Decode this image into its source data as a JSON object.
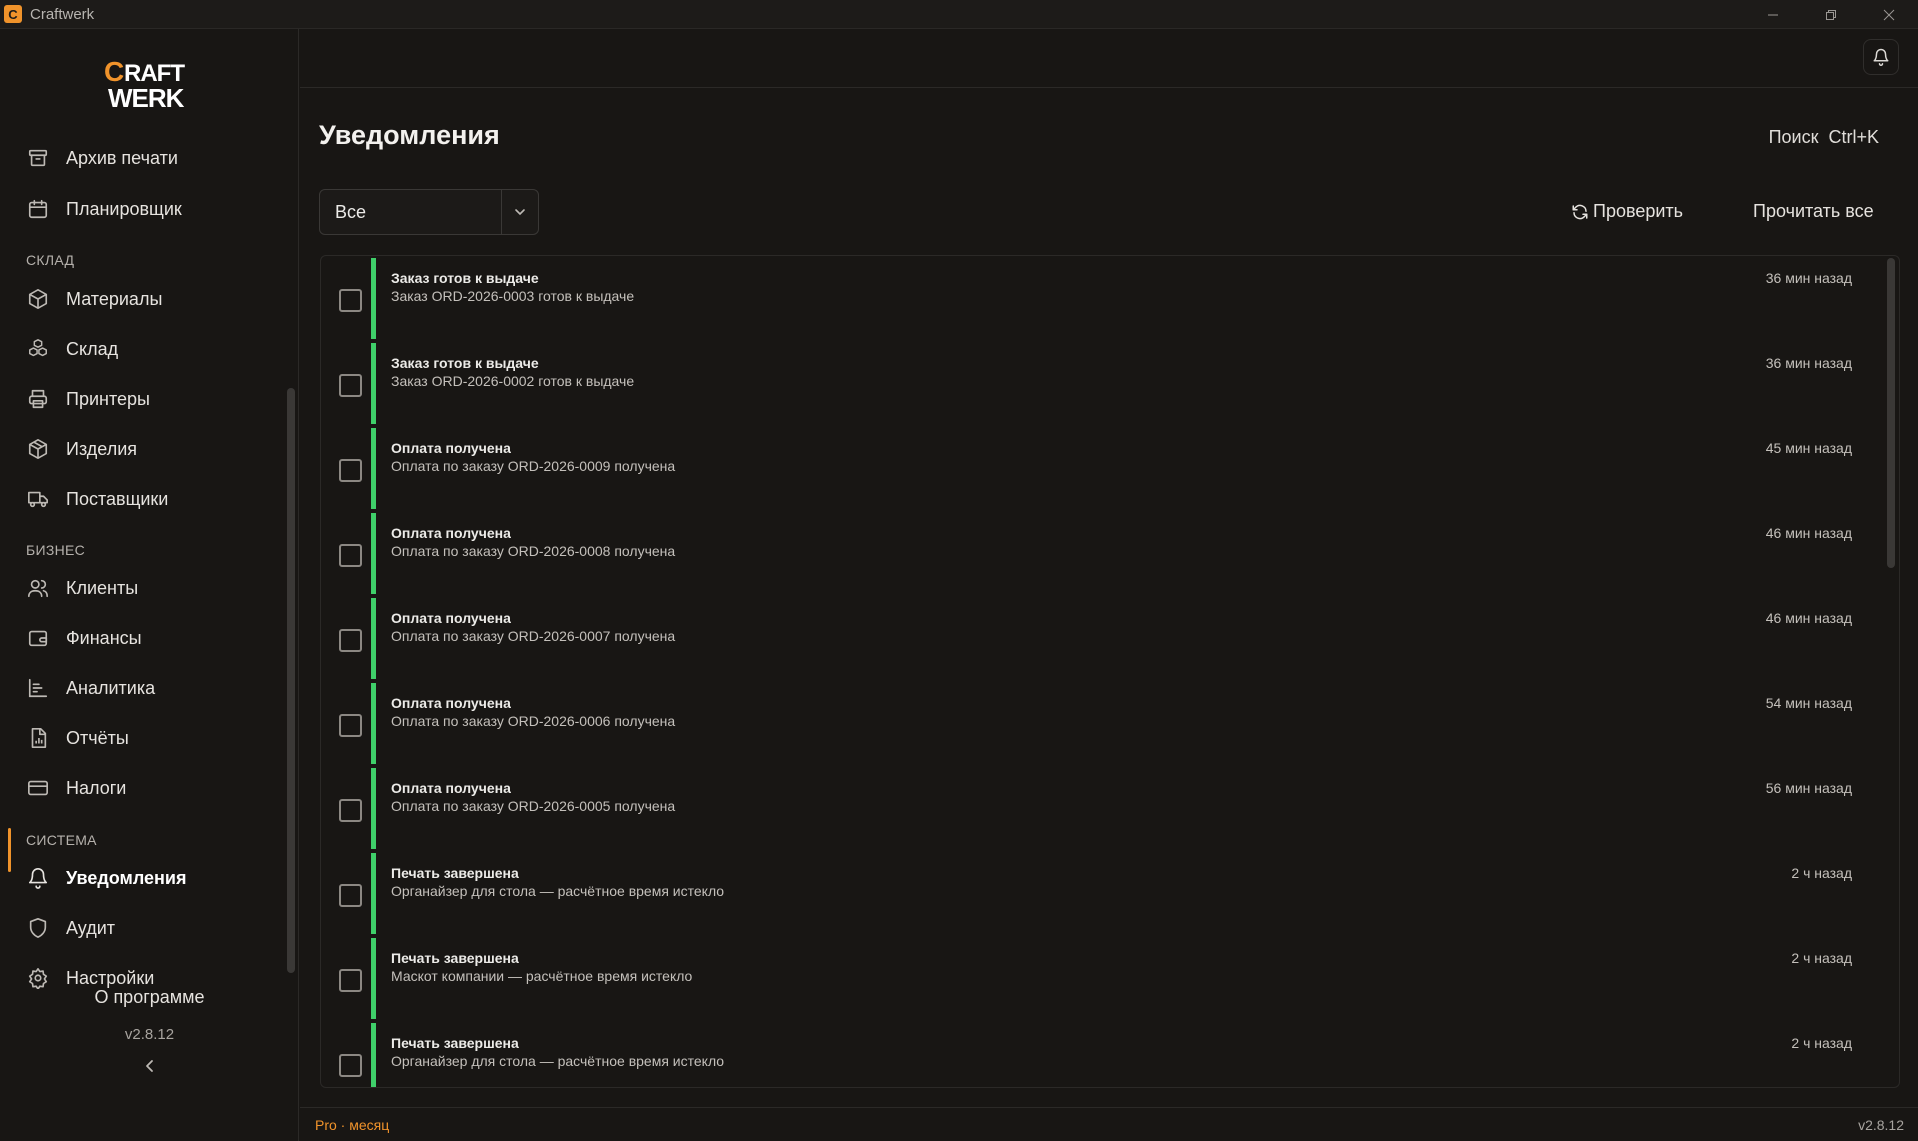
{
  "window": {
    "title": "Craftwerk"
  },
  "brand": {
    "logo_line1": "CRAFT",
    "logo_line2": "WERK",
    "accent_color": "#f0932b"
  },
  "sidebar": {
    "items_top": [
      {
        "label": "Архив печати",
        "icon": "archive-icon"
      },
      {
        "label": "Планировщик",
        "icon": "calendar-icon"
      }
    ],
    "section_warehouse": "СКЛАД",
    "items_warehouse": [
      {
        "label": "Материалы",
        "icon": "package-icon"
      },
      {
        "label": "Склад",
        "icon": "boxes-icon"
      },
      {
        "label": "Принтеры",
        "icon": "printer-icon"
      },
      {
        "label": "Изделия",
        "icon": "box-icon"
      },
      {
        "label": "Поставщики",
        "icon": "truck-icon"
      }
    ],
    "section_business": "БИЗНЕС",
    "items_business": [
      {
        "label": "Клиенты",
        "icon": "users-icon"
      },
      {
        "label": "Финансы",
        "icon": "wallet-icon"
      },
      {
        "label": "Аналитика",
        "icon": "bar-chart-icon"
      },
      {
        "label": "Отчёты",
        "icon": "report-icon"
      },
      {
        "label": "Налоги",
        "icon": "credit-card-icon"
      }
    ],
    "section_system": "СИСТЕМА",
    "items_system": [
      {
        "label": "Уведомления",
        "icon": "bell-icon",
        "active": true
      },
      {
        "label": "Аудит",
        "icon": "shield-icon"
      },
      {
        "label": "Настройки",
        "icon": "gear-icon"
      }
    ],
    "about": "О программе",
    "version": "v2.8.12"
  },
  "header": {
    "page_title": "Уведомления",
    "search_hint": "Поиск  Ctrl+K",
    "filter_value": "Все",
    "check_label": "Проверить",
    "read_all_label": "Прочитать все"
  },
  "notifications": [
    {
      "title": "Заказ готов к выдаче",
      "body": "Заказ ORD-2026-0003 готов к выдаче",
      "time": "36 мин назад"
    },
    {
      "title": "Заказ готов к выдаче",
      "body": "Заказ ORD-2026-0002 готов к выдаче",
      "time": "36 мин назад"
    },
    {
      "title": "Оплата получена",
      "body": "Оплата по заказу ORD-2026-0009 получена",
      "time": "45 мин назад"
    },
    {
      "title": "Оплата получена",
      "body": "Оплата по заказу ORD-2026-0008 получена",
      "time": "46 мин назад"
    },
    {
      "title": "Оплата получена",
      "body": "Оплата по заказу ORD-2026-0007 получена",
      "time": "46 мин назад"
    },
    {
      "title": "Оплата получена",
      "body": "Оплата по заказу ORD-2026-0006 получена",
      "time": "54 мин назад"
    },
    {
      "title": "Оплата получена",
      "body": "Оплата по заказу ORD-2026-0005 получена",
      "time": "56 мин назад"
    },
    {
      "title": "Печать завершена",
      "body": "Органайзер для стола — расчётное время истекло",
      "time": "2 ч назад"
    },
    {
      "title": "Печать завершена",
      "body": "Маскот компании — расчётное время истекло",
      "time": "2 ч назад"
    },
    {
      "title": "Печать завершена",
      "body": "Органайзер для стола — расчётное время истекло",
      "time": "2 ч назад"
    }
  ],
  "footer": {
    "plan": "Pro · месяц",
    "version": "v2.8.12"
  },
  "colors": {
    "success_accent": "#3fcf6a",
    "background": "#181614"
  }
}
